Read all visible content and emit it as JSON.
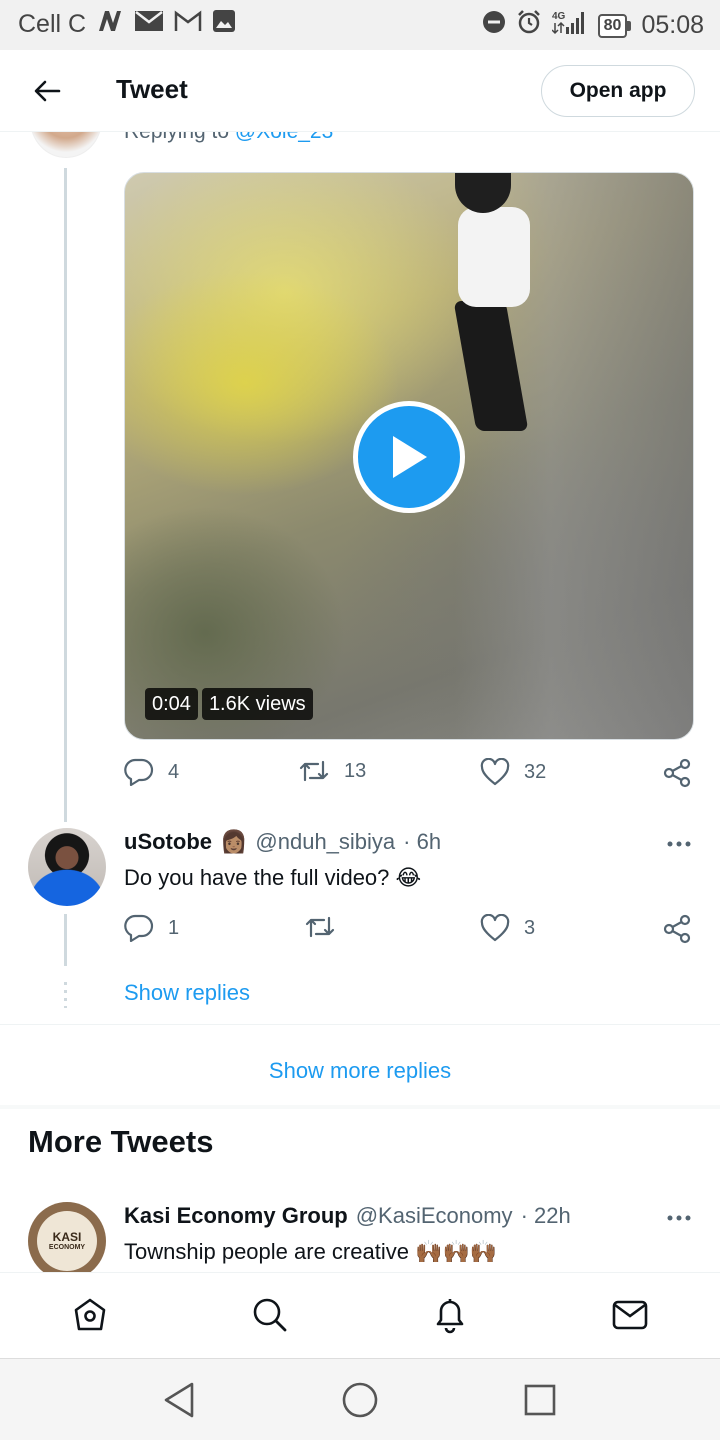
{
  "status_bar": {
    "carrier": "Cell C",
    "network": "4G",
    "battery": "80",
    "time": "05:08"
  },
  "header": {
    "title": "Tweet",
    "open_app_label": "Open app"
  },
  "parent_tweet": {
    "replying_prefix": "Replying to",
    "replying_handle": "@Xole_23",
    "video": {
      "duration": "0:04",
      "views": "1.6K views"
    },
    "stats": {
      "replies": "4",
      "retweets": "13",
      "likes": "32"
    }
  },
  "reply_tweet": {
    "display_name": "uSotobe",
    "name_emoji": "👩🏽",
    "handle": "@nduh_sibiya",
    "time": "· 6h",
    "text": "Do you have the full video? 😂",
    "stats": {
      "replies": "1",
      "retweets": "",
      "likes": "3"
    },
    "show_replies_label": "Show replies"
  },
  "show_more_replies_label": "Show more replies",
  "more_tweets": {
    "section_title": "More Tweets",
    "tweet": {
      "display_name": "Kasi Economy Group",
      "handle": "@KasiEconomy",
      "time": "· 22h",
      "text": "Township people are creative 🙌🏾🙌🏾🙌🏾",
      "avatar_text_1": "KASI",
      "avatar_text_2": "ECONOMY"
    }
  },
  "colors": {
    "accent": "#1d9bf0",
    "text_primary": "#0f1419",
    "text_secondary": "#536471"
  }
}
